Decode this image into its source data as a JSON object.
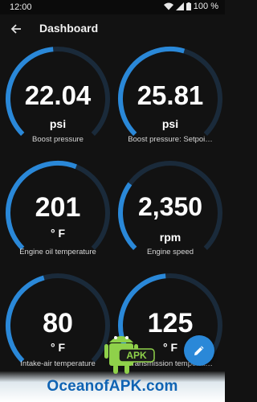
{
  "status": {
    "time": "12:00",
    "battery": "100 %"
  },
  "header": {
    "title": "Dashboard"
  },
  "gauges": [
    {
      "value": "22.04",
      "unit": "psi",
      "label": "Boost pressure",
      "fill": 0.48
    },
    {
      "value": "25.81",
      "unit": "psi",
      "label": "Boost pressure: Setpoi…",
      "fill": 0.56
    },
    {
      "value": "201",
      "unit": "° F",
      "label": "Engine oil temperature",
      "fill": 0.58
    },
    {
      "value": "2,350",
      "unit": "rpm",
      "label": "Engine speed",
      "fill": 0.3
    },
    {
      "value": "80",
      "unit": "° F",
      "label": "Intake-air temperature",
      "fill": 0.44
    },
    {
      "value": "125",
      "unit": "° F",
      "label": "Transmission temperat…",
      "fill": 0.48
    }
  ],
  "watermark": {
    "text": "OceanofAPK.com",
    "logo_text": "APK"
  },
  "colors": {
    "accent": "#2a88d8",
    "track": "#1a2a3a",
    "background": "#121212"
  }
}
